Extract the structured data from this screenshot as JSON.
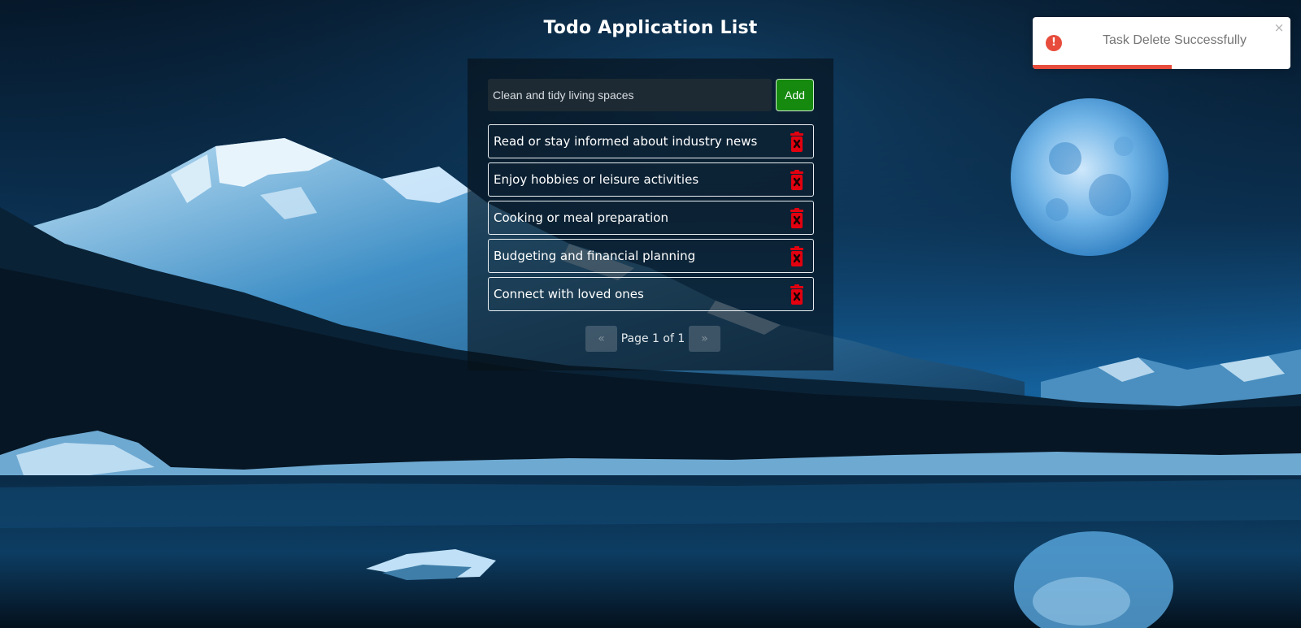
{
  "app": {
    "title": "Todo Application List"
  },
  "composer": {
    "input_value": "Clean and tidy living spaces",
    "add_label": "Add"
  },
  "tasks": [
    {
      "text": "Read or stay informed about industry news"
    },
    {
      "text": "Enjoy hobbies or leisure activities"
    },
    {
      "text": "Cooking or meal preparation"
    },
    {
      "text": "Budgeting and financial planning"
    },
    {
      "text": "Connect with loved ones"
    }
  ],
  "pagination": {
    "label": "Page 1 of 1",
    "prev_icon": "double-chevron-left-icon",
    "next_icon": "double-chevron-right-icon",
    "prev_glyph": "«",
    "next_glyph": "»"
  },
  "toast": {
    "message": "Task Delete Successfully",
    "icon": "error-icon",
    "icon_glyph": "!",
    "close_glyph": "×",
    "progress_fraction": 0.54,
    "accent": "#e74c3c"
  },
  "theme": {
    "add_button_color": "#158a0f",
    "delete_icon_color": "#e3000f",
    "delete_icon": "trash-icon"
  }
}
